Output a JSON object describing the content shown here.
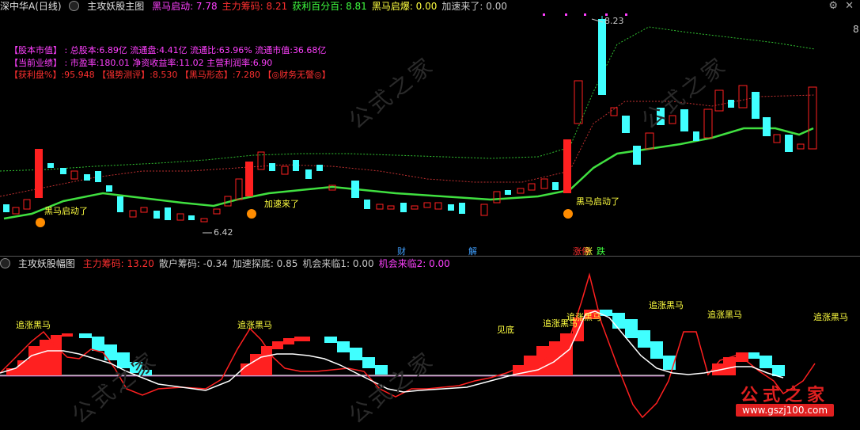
{
  "main_panel": {
    "title": "深中华A(日线)",
    "indicator_name": "主攻妖股主图",
    "readouts": [
      {
        "label": "黑马启动:",
        "value": "7.78",
        "color": "#ff40ff"
      },
      {
        "label": "主力筹码:",
        "value": "8.21",
        "color": "#ff3030"
      },
      {
        "label": "获利百分百:",
        "value": "8.81",
        "color": "#40ff40"
      },
      {
        "label": "黑马启爆:",
        "value": "0.00",
        "color": "#ffff40"
      },
      {
        "label": "加速来了:",
        "value": "0.00",
        "color": "#c8c8c8"
      }
    ],
    "info_lines": [
      {
        "text": "【股本市值】 : 总股本:6.89亿 流通盘:4.41亿 流通比:63.96% 流通市值:36.68亿",
        "color": "#ff40ff"
      },
      {
        "text": "【当前业绩】 : 市盈率:180.01 净资收益率:11.02 主营利润率:6.90",
        "color": "#ff40ff"
      },
      {
        "text": "【获利盘%】:95.948 【强势测评】:8.530 【黑马形态】:7.280 【◎财务无警◎】",
        "color": "#ff3030"
      }
    ],
    "annotations": {
      "high_price": "8.23",
      "low_price": "6.42",
      "accel_label": "加速来了",
      "signal_1": "黑马启动了",
      "signal_2": "黑马启动了",
      "bottom_cai": "财",
      "bottom_jie": "解",
      "bottom_zt": "涨停",
      "bottom_zhang": "涨",
      "bottom_die": "跌",
      "axis_tick": "8"
    },
    "icons": {
      "settings": "gear-icon",
      "close": "close-icon"
    }
  },
  "sub_panel": {
    "indicator_name": "主攻妖股幅图",
    "readouts": [
      {
        "label": "主力筹码:",
        "value": "13.20",
        "color": "#ff3030"
      },
      {
        "label": "散户筹码:",
        "value": "-0.34",
        "color": "#c8c8c8"
      },
      {
        "label": "加速探底:",
        "value": "0.85",
        "color": "#c8c8c8"
      },
      {
        "label": "机会来临1:",
        "value": "0.00",
        "color": "#c8c8c8"
      },
      {
        "label": "机会来临2:",
        "value": "0.00",
        "color": "#ff40ff"
      }
    ],
    "labels": {
      "l1": "追涨黑马",
      "l2": "追涨黑马",
      "l3": "见底",
      "l4": "追涨黑马",
      "l5": "追涨黑马",
      "l6": "追涨黑马",
      "l7": "追涨黑马",
      "l8": "追涨黑马"
    }
  },
  "watermark": {
    "text": "公式之家",
    "url": "www.gszj100.com"
  },
  "colors": {
    "up": "#ff2020",
    "down": "#40ffff",
    "ma_green": "#40e040",
    "label_yellow": "#ffff40",
    "background": "#000000"
  }
}
